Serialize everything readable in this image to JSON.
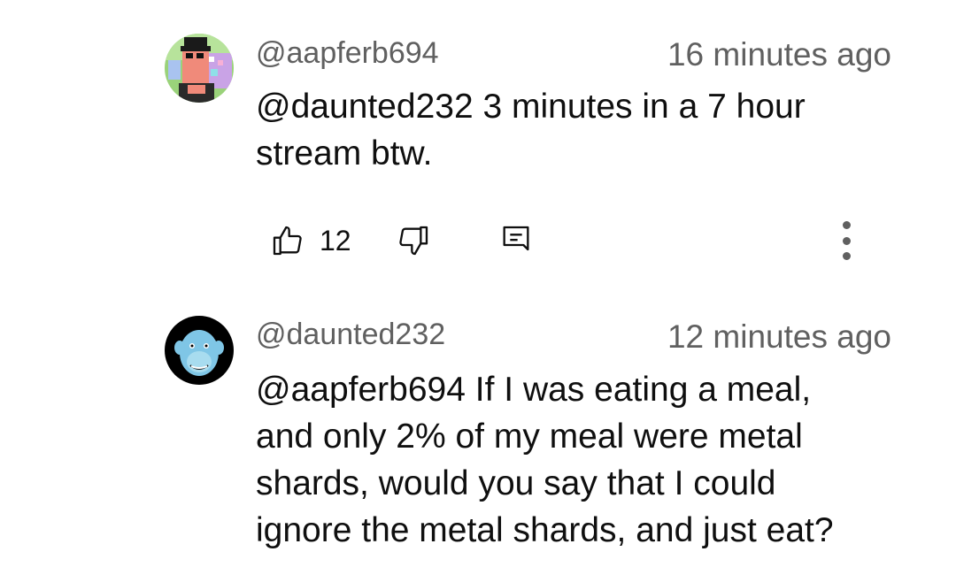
{
  "comments": [
    {
      "handle": "@aapferb694",
      "timestamp": "16 minutes ago",
      "text_line1": "@daunted232 3 minutes in a 7 hour",
      "text_line2": "stream btw.",
      "like_count": "12",
      "avatar_icon": "pixel-art-avatar"
    },
    {
      "handle": "@daunted232",
      "timestamp": "12 minutes ago",
      "text_line1": "@aapferb694 If I was eating a meal,",
      "text_line2": "and only 2% of my meal were metal",
      "text_line3": "shards, would you say that I could",
      "text_line4": "ignore the metal shards, and just eat?",
      "avatar_icon": "blue-ape-avatar"
    }
  ],
  "icons": {
    "like": "thumbs-up-icon",
    "dislike": "thumbs-down-icon",
    "reply": "reply-icon",
    "more": "more-vertical-icon"
  },
  "colors": {
    "secondary_text": "#606060",
    "primary_text": "#0f0f0f",
    "avatar2_face": "#7fc6e6"
  }
}
